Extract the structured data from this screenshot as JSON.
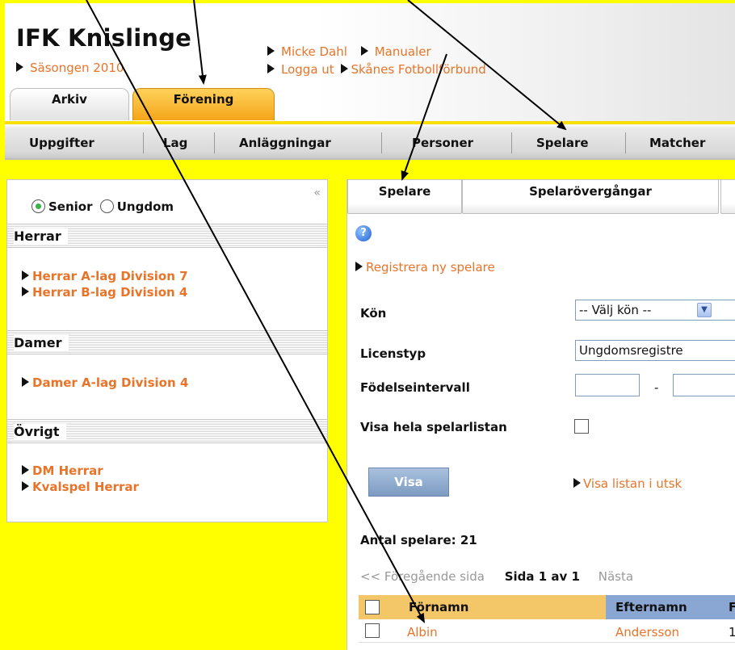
{
  "header": {
    "club_name": "IFK Knislinge",
    "season": "Säsongen 2010",
    "links_row1": [
      "Micke Dahl",
      "Manualer"
    ],
    "links_row2": [
      "Logga ut",
      "Skånes Fotbollförbund"
    ],
    "tabs": [
      {
        "label": "Arkiv"
      },
      {
        "label": "Förening"
      }
    ]
  },
  "navbar": {
    "items": [
      "Uppgifter",
      "Lag",
      "Anläggningar",
      "Personer",
      "Spelare",
      "Matcher"
    ]
  },
  "sidebar": {
    "radio_senior": "Senior",
    "radio_ungdom": "Ungdom",
    "collapse_glyph": "«",
    "sections": [
      {
        "title": "Herrar",
        "items": [
          "Herrar A-lag Division 7",
          "Herrar B-lag Division 4"
        ]
      },
      {
        "title": "Damer",
        "items": [
          "Damer A-lag Division 4"
        ]
      },
      {
        "title": "Övrigt",
        "items": [
          "DM Herrar",
          "Kvalspel Herrar"
        ]
      }
    ]
  },
  "main": {
    "tabs": [
      "Spelare",
      "Spelarövergångar"
    ],
    "help_glyph": "?",
    "register_link": "Registrera ny spelare",
    "filters": {
      "kon_label": "Kön",
      "kon_value": "-- Välj kön --",
      "licens_label": "Licenstyp",
      "licens_value": "Ungdomsregistre",
      "fodelse_label": "Födelseintervall",
      "fodelse_sep": "-",
      "visa_hela_label": "Visa hela spelarlistan"
    },
    "visa_button": "Visa",
    "print_link": "Visa listan i utsk",
    "count_text": "Antal spelare: 21",
    "pager": {
      "prev": "<< Föregående sida",
      "page": "Sida 1 av 1",
      "next": "Nästa"
    },
    "table": {
      "headers": [
        "Förnamn",
        "Efternamn",
        "F"
      ],
      "rows": [
        {
          "fornamn": "Albin",
          "efternamn": "Andersson",
          "extra": "1"
        }
      ]
    }
  }
}
